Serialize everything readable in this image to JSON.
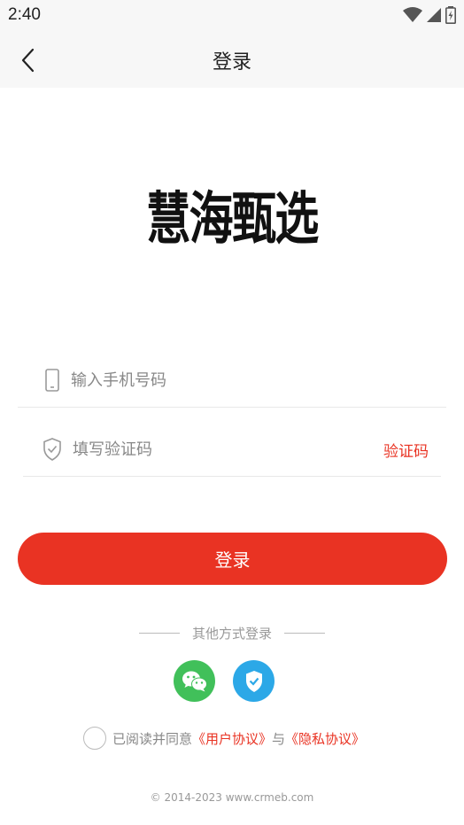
{
  "status_bar": {
    "time": "2:40",
    "icons": [
      "wifi-icon",
      "signal-icon",
      "battery-icon"
    ]
  },
  "nav": {
    "title": "登录",
    "back_icon": "chevron-left-icon"
  },
  "brand": {
    "name": "慧海甄选"
  },
  "form": {
    "phone_placeholder": "输入手机号码",
    "phone_value": "",
    "phone_icon": "phone-icon",
    "code_placeholder": "填写验证码",
    "code_value": "",
    "code_icon": "shield-check-icon",
    "code_button": "验证码"
  },
  "login_button": "登录",
  "other_login": {
    "label": "其他方式登录",
    "options": [
      "wechat-icon",
      "shield-verify-icon"
    ]
  },
  "agreement": {
    "prefix": "已阅读并同意",
    "user_agreement": "《用户协议》",
    "and": "与",
    "privacy_agreement": "《隐私协议》"
  },
  "footer": {
    "copyright": "© 2014-2023  www.crmeb.com"
  },
  "colors": {
    "accent": "#e93323",
    "wechat": "#41c05a",
    "verify": "#2ca8e7",
    "header_bg": "#f7f7f7"
  }
}
